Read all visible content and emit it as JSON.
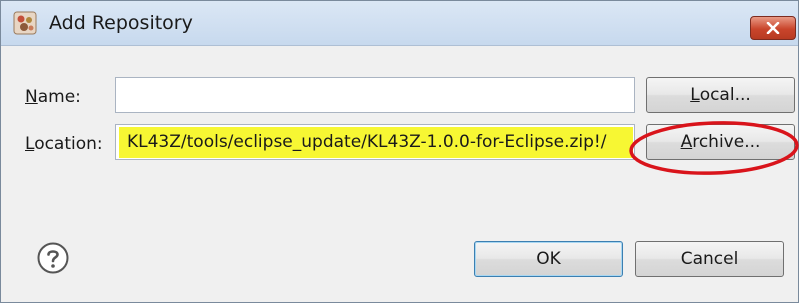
{
  "window": {
    "title": "Add Repository",
    "icon": "eclipse-plugin-icon",
    "close_icon": "close-icon"
  },
  "form": {
    "name_label_mnemonic": "N",
    "name_label_rest": "ame:",
    "name_value": "",
    "location_label_mnemonic": "L",
    "location_label_rest": "ocation:",
    "location_value": "KL43Z/tools/eclipse_update/KL43Z-1.0.0-for-Eclipse.zip!/"
  },
  "buttons": {
    "local_mnemonic": "L",
    "local_rest": "ocal...",
    "archive_mnemonic": "A",
    "archive_rest": "rchive...",
    "ok": "OK",
    "cancel": "Cancel"
  },
  "help_icon": "help-icon",
  "annotation": {
    "highlight_color": "#f7f733",
    "circle_color": "#d9141b"
  }
}
